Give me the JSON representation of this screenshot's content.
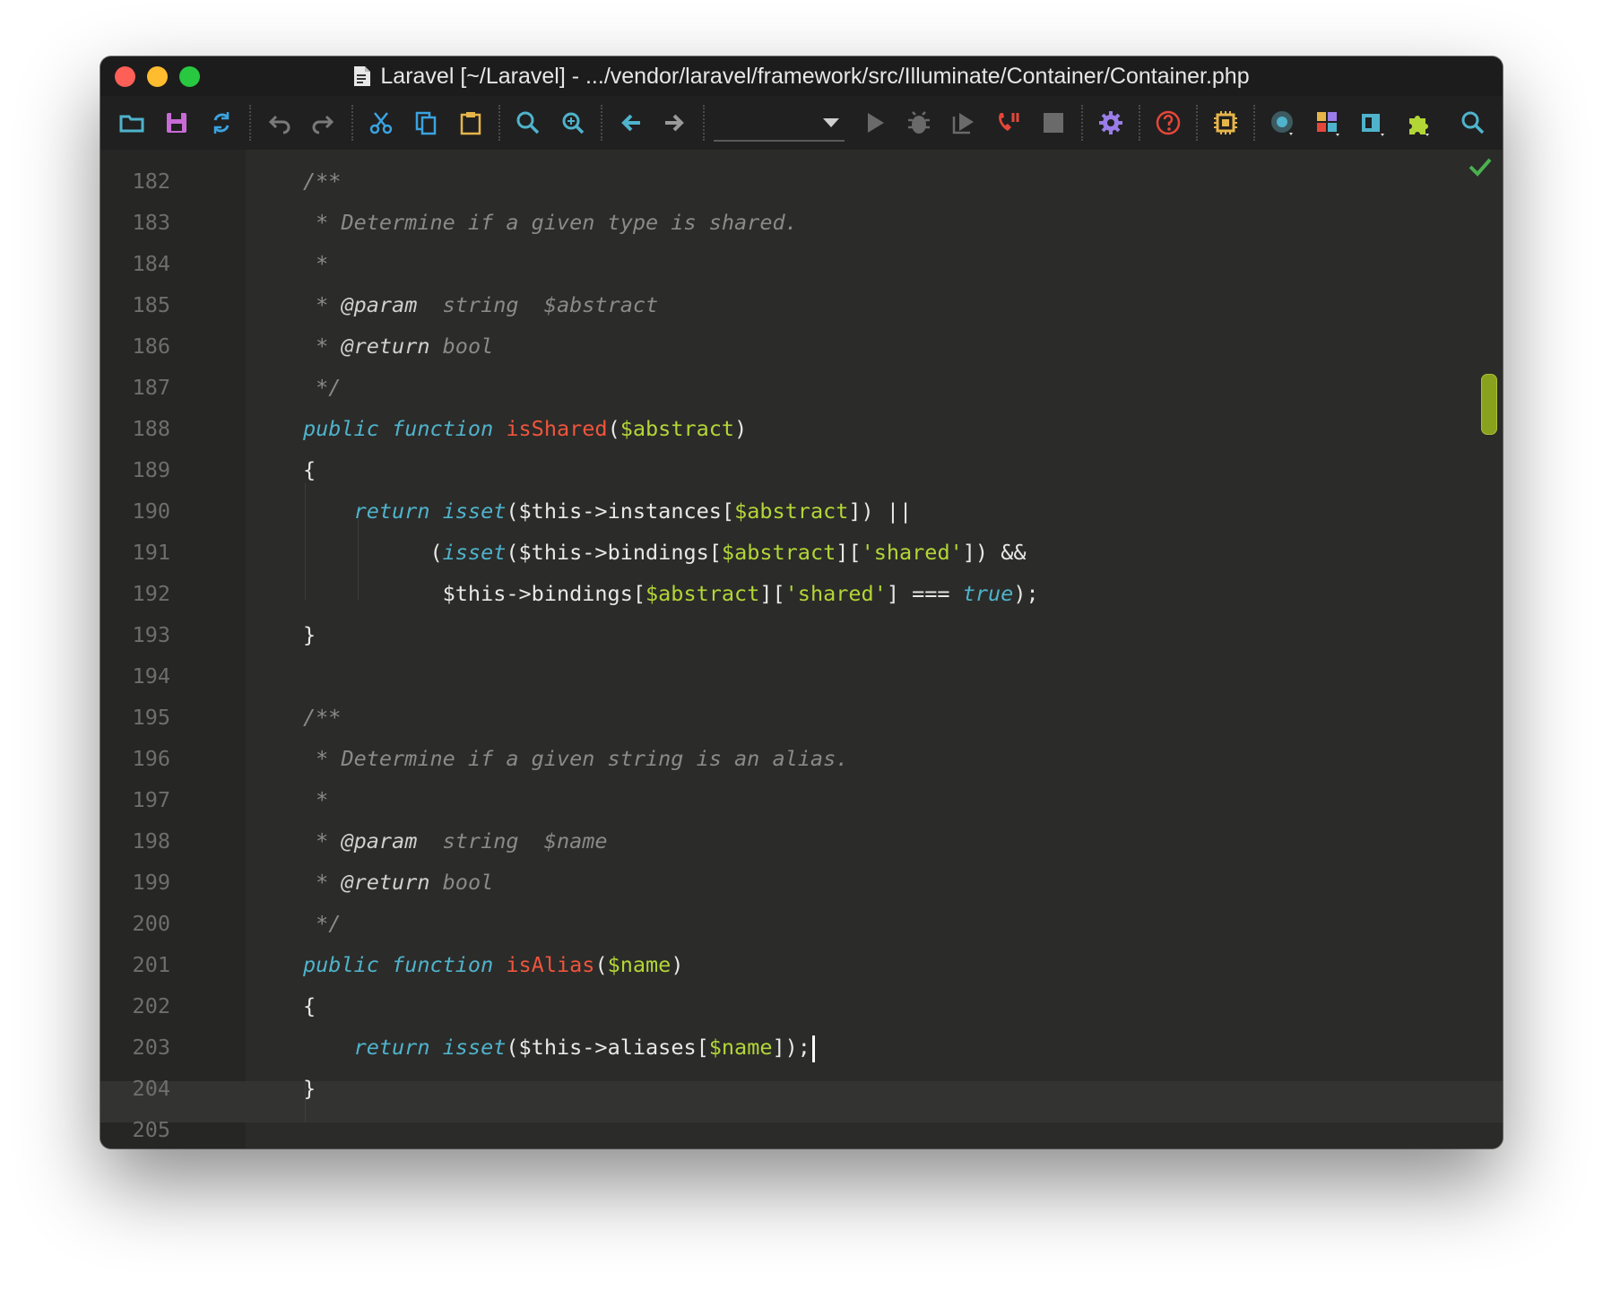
{
  "window": {
    "title": "Laravel [~/Laravel] - .../vendor/laravel/framework/src/Illuminate/Container/Container.php"
  },
  "toolbar": {
    "buttons": [
      {
        "name": "open-folder-icon",
        "color": "#4fb3cc"
      },
      {
        "name": "save-icon",
        "color": "#c86bd6"
      },
      {
        "name": "sync-icon",
        "color": "#3aa3e0"
      },
      {
        "name": "undo-icon",
        "color": "#7a7a7a"
      },
      {
        "name": "redo-icon",
        "color": "#7a7a7a"
      },
      {
        "name": "cut-icon",
        "color": "#3aa3e0"
      },
      {
        "name": "copy-icon",
        "color": "#3aa3e0"
      },
      {
        "name": "paste-icon",
        "color": "#e6b54a"
      },
      {
        "name": "find-icon",
        "color": "#4fb3cc"
      },
      {
        "name": "replace-icon",
        "color": "#4fb3cc"
      },
      {
        "name": "back-icon",
        "color": "#4fb3cc"
      },
      {
        "name": "forward-icon",
        "color": "#9a9a9a"
      },
      {
        "name": "run-icon",
        "color": "#6a6a6a"
      },
      {
        "name": "debug-icon",
        "color": "#6a6a6a"
      },
      {
        "name": "run-coverage-icon",
        "color": "#6a6a6a"
      },
      {
        "name": "listen-debug-icon",
        "color": "#e5473a"
      },
      {
        "name": "stop-icon",
        "color": "#6a6a6a"
      },
      {
        "name": "settings-icon",
        "color": "#9a7de8"
      },
      {
        "name": "help-icon",
        "color": "#e5473a"
      },
      {
        "name": "sdk-icon",
        "color": "#e6b54a"
      },
      {
        "name": "vcs-icon",
        "color": "#4fb3cc"
      },
      {
        "name": "structure-icon",
        "color": "#e5473a"
      },
      {
        "name": "project-icon",
        "color": "#4fb3cc"
      },
      {
        "name": "plugins-icon",
        "color": "#b3d637"
      },
      {
        "name": "search-everywhere-icon",
        "color": "#4fb3cc"
      }
    ],
    "run_config": ""
  },
  "editor": {
    "status": "check-icon",
    "cursor_line": "203",
    "lines": [
      {
        "n": "182",
        "tokens": [
          {
            "t": "/**",
            "c": "cmt"
          }
        ]
      },
      {
        "n": "183",
        "tokens": [
          {
            "t": " * Determine if a given type is shared.",
            "c": "cmt"
          }
        ]
      },
      {
        "n": "184",
        "tokens": [
          {
            "t": " *",
            "c": "cmt"
          }
        ]
      },
      {
        "n": "185",
        "tokens": [
          {
            "t": " * ",
            "c": "cmt"
          },
          {
            "t": "@param",
            "c": "tag"
          },
          {
            "t": "  string  $abstract",
            "c": "cmt"
          }
        ]
      },
      {
        "n": "186",
        "tokens": [
          {
            "t": " * ",
            "c": "cmt"
          },
          {
            "t": "@return",
            "c": "tag"
          },
          {
            "t": " bool",
            "c": "cmt"
          }
        ]
      },
      {
        "n": "187",
        "tokens": [
          {
            "t": " */",
            "c": "cmt"
          }
        ]
      },
      {
        "n": "188",
        "tokens": [
          {
            "t": "public",
            "c": "kw"
          },
          {
            "t": " ",
            "c": "pl"
          },
          {
            "t": "function",
            "c": "kw"
          },
          {
            "t": " ",
            "c": "pl"
          },
          {
            "t": "isShared",
            "c": "fn"
          },
          {
            "t": "(",
            "c": "pl"
          },
          {
            "t": "$abstract",
            "c": "var"
          },
          {
            "t": ")",
            "c": "pl"
          }
        ]
      },
      {
        "n": "189",
        "tokens": [
          {
            "t": "{",
            "c": "pl"
          }
        ]
      },
      {
        "n": "190",
        "tokens": [
          {
            "t": "    ",
            "c": "pl"
          },
          {
            "t": "return",
            "c": "kw"
          },
          {
            "t": " ",
            "c": "pl"
          },
          {
            "t": "isset",
            "c": "kw"
          },
          {
            "t": "($this->instances[",
            "c": "pl"
          },
          {
            "t": "$abstract",
            "c": "var"
          },
          {
            "t": "]) ||",
            "c": "pl"
          }
        ]
      },
      {
        "n": "191",
        "tokens": [
          {
            "t": "          (",
            "c": "pl"
          },
          {
            "t": "isset",
            "c": "kw"
          },
          {
            "t": "($this->bindings[",
            "c": "pl"
          },
          {
            "t": "$abstract",
            "c": "var"
          },
          {
            "t": "][",
            "c": "pl"
          },
          {
            "t": "'shared'",
            "c": "str"
          },
          {
            "t": "]) &&",
            "c": "pl"
          }
        ]
      },
      {
        "n": "192",
        "tokens": [
          {
            "t": "           $this->bindings[",
            "c": "pl"
          },
          {
            "t": "$abstract",
            "c": "var"
          },
          {
            "t": "][",
            "c": "pl"
          },
          {
            "t": "'shared'",
            "c": "str"
          },
          {
            "t": "] === ",
            "c": "pl"
          },
          {
            "t": "true",
            "c": "true"
          },
          {
            "t": ");",
            "c": "pl"
          }
        ]
      },
      {
        "n": "193",
        "tokens": [
          {
            "t": "}",
            "c": "pl"
          }
        ]
      },
      {
        "n": "194",
        "tokens": []
      },
      {
        "n": "195",
        "tokens": [
          {
            "t": "/**",
            "c": "cmt"
          }
        ]
      },
      {
        "n": "196",
        "tokens": [
          {
            "t": " * Determine if a given string is an alias.",
            "c": "cmt"
          }
        ]
      },
      {
        "n": "197",
        "tokens": [
          {
            "t": " *",
            "c": "cmt"
          }
        ]
      },
      {
        "n": "198",
        "tokens": [
          {
            "t": " * ",
            "c": "cmt"
          },
          {
            "t": "@param",
            "c": "tag"
          },
          {
            "t": "  string  $name",
            "c": "cmt"
          }
        ]
      },
      {
        "n": "199",
        "tokens": [
          {
            "t": " * ",
            "c": "cmt"
          },
          {
            "t": "@return",
            "c": "tag"
          },
          {
            "t": " bool",
            "c": "cmt"
          }
        ]
      },
      {
        "n": "200",
        "tokens": [
          {
            "t": " */",
            "c": "cmt"
          }
        ]
      },
      {
        "n": "201",
        "tokens": [
          {
            "t": "public",
            "c": "kw"
          },
          {
            "t": " ",
            "c": "pl"
          },
          {
            "t": "function",
            "c": "kw"
          },
          {
            "t": " ",
            "c": "pl"
          },
          {
            "t": "isAlias",
            "c": "fn"
          },
          {
            "t": "(",
            "c": "pl"
          },
          {
            "t": "$name",
            "c": "var"
          },
          {
            "t": ")",
            "c": "pl"
          }
        ]
      },
      {
        "n": "202",
        "tokens": [
          {
            "t": "{",
            "c": "pl"
          }
        ]
      },
      {
        "n": "203",
        "tokens": [
          {
            "t": "    ",
            "c": "pl"
          },
          {
            "t": "return",
            "c": "kw"
          },
          {
            "t": " ",
            "c": "pl"
          },
          {
            "t": "isset",
            "c": "kw"
          },
          {
            "t": "($this->aliases[",
            "c": "pl"
          },
          {
            "t": "$name",
            "c": "var"
          },
          {
            "t": "]);",
            "c": "pl"
          }
        ]
      },
      {
        "n": "204",
        "tokens": [
          {
            "t": "}",
            "c": "pl"
          }
        ]
      },
      {
        "n": "205",
        "tokens": []
      }
    ]
  }
}
